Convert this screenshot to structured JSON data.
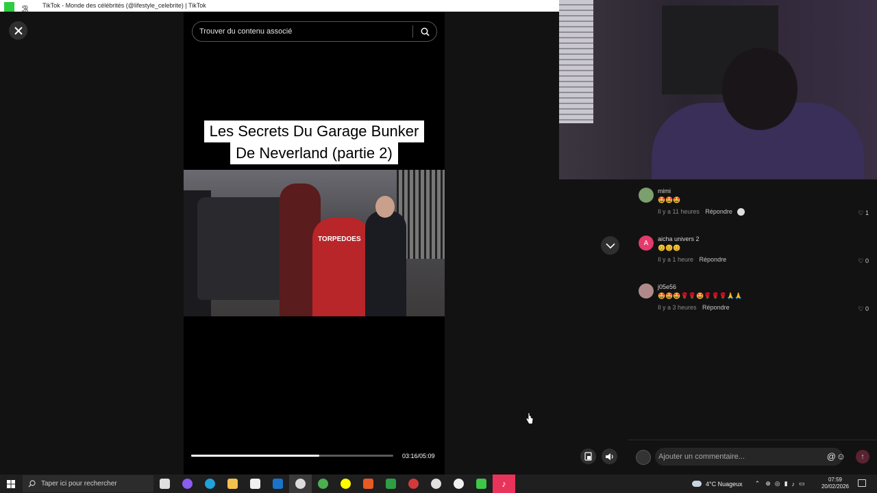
{
  "browser": {
    "window_title": "TikTok - Monde des célébrités (@lifestyle_celebrite) | TikTok"
  },
  "search": {
    "placeholder": "Trouver du contenu associé"
  },
  "video": {
    "caption_line1": "Les Secrets Du Garage Bunker",
    "caption_line2": "De Neverland (partie 2)",
    "jacket_text": "TORPEDOES",
    "time": "03:16/05:09",
    "progress": 0.634
  },
  "comments": [
    {
      "user": "mimi",
      "text": "🤩🤩🤩",
      "time": "Il y a 11 heures",
      "reply": "Répondre",
      "likes": "1",
      "avatar_color": "#7b9f6e",
      "avatar_letter": ""
    },
    {
      "user": "aicha univers 2",
      "text": "😊😊😊",
      "time": "Il y a 1 heure",
      "reply": "Répondre",
      "likes": "0",
      "avatar_color": "#e43a6c",
      "avatar_letter": "A"
    },
    {
      "user": "j05e56",
      "text": "🤩🤩🤩🌹🌹🤩🌹🌹🌹🙏🙏",
      "time": "Il y a 3 heures",
      "reply": "Répondre",
      "likes": "0",
      "avatar_color": "#b08a8a",
      "avatar_letter": ""
    }
  ],
  "comment_input": {
    "placeholder": "Ajouter un commentaire..."
  },
  "taskbar": {
    "search_placeholder": "Taper ici pour rechercher",
    "weather": "4°C  Nuageux",
    "time": "07:59",
    "date": "20/02/2026",
    "apps": [
      {
        "name": "task-view",
        "color": "#e0e0e0"
      },
      {
        "name": "copilot",
        "color": "#8a5cf0"
      },
      {
        "name": "edge",
        "color": "#1fa3d8"
      },
      {
        "name": "file-explorer",
        "color": "#f2c14e"
      },
      {
        "name": "store",
        "color": "#f0f0f0"
      },
      {
        "name": "outlook",
        "color": "#1a73c8"
      },
      {
        "name": "obs",
        "color": "#dddddd"
      },
      {
        "name": "chrome",
        "color": "#4caf50"
      },
      {
        "name": "snapchat",
        "color": "#fffc00"
      },
      {
        "name": "office",
        "color": "#e85a24"
      },
      {
        "name": "stocks",
        "color": "#2e9e44"
      },
      {
        "name": "recorder",
        "color": "#d23a3a"
      },
      {
        "name": "settings",
        "color": "#e0e0e0"
      },
      {
        "name": "chatgpt",
        "color": "#f0f0f0"
      },
      {
        "name": "player",
        "color": "#3ec54a"
      },
      {
        "name": "tiktok",
        "color": "#ffffff"
      }
    ]
  }
}
